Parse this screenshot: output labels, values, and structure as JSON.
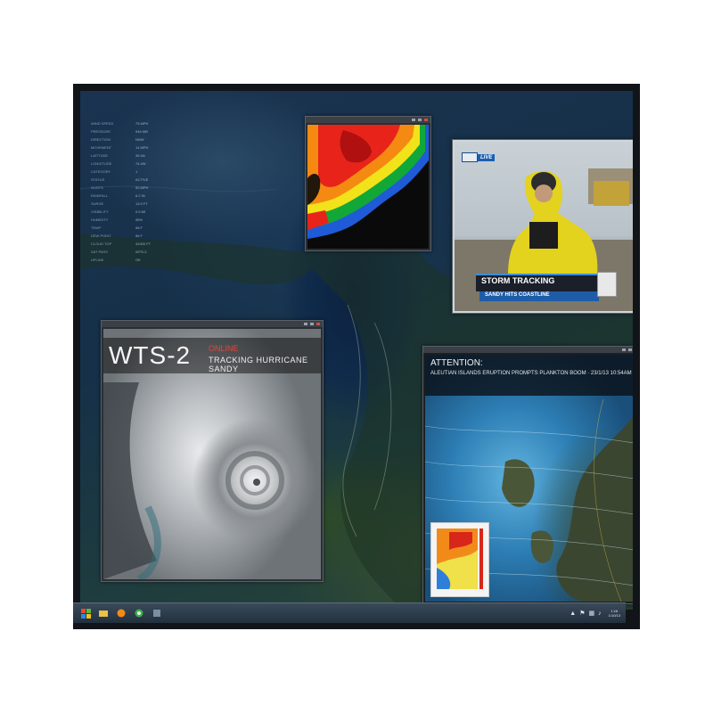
{
  "data_panel": {
    "rows": [
      {
        "key": "WIND SPEED",
        "val": "75 MPH"
      },
      {
        "key": "PRESSURE",
        "val": "946 MB"
      },
      {
        "key": "DIRECTION",
        "val": "NNW"
      },
      {
        "key": "MOVEMENT",
        "val": "14 MPH"
      },
      {
        "key": "LATITUDE",
        "val": "39.4N"
      },
      {
        "key": "LONGITUDE",
        "val": "74.4W"
      },
      {
        "key": "CATEGORY",
        "val": "1"
      },
      {
        "key": "STATUS",
        "val": "ACTIVE"
      },
      {
        "key": "GUSTS",
        "val": "90 MPH"
      },
      {
        "key": "RAINFALL",
        "val": "6.2 IN"
      },
      {
        "key": "SURGE",
        "val": "13.9 FT"
      },
      {
        "key": "VISIBILITY",
        "val": "0.5 MI"
      },
      {
        "key": "HUMIDITY",
        "val": "98%"
      },
      {
        "key": "TEMP",
        "val": "58 F"
      },
      {
        "key": "DEW POINT",
        "val": "56 F"
      },
      {
        "key": "CLOUD TOP",
        "val": "41000 FT"
      },
      {
        "key": "SAT PASS",
        "val": "WTS-2"
      },
      {
        "key": "UPLINK",
        "val": "OK"
      }
    ]
  },
  "news": {
    "live": "LIVE",
    "headline": "STORM TRACKING",
    "subhead": "SANDY HITS COASTLINE"
  },
  "wts": {
    "title": "WTS-2",
    "status": "ONLINE",
    "subtitle": "TRACKING HURRICANE SANDY"
  },
  "attention": {
    "title": "ATTENTION:",
    "line": "ALEUTIAN ISLANDS ERUPTION PROMPTS PLANKTON BOOM · 23/1/13 10:54AM"
  },
  "taskbar": {
    "time": "1:16",
    "date": "1/10/13"
  },
  "colors": {
    "accent_red": "#e0463c",
    "news_blue": "#1b5fb3"
  }
}
